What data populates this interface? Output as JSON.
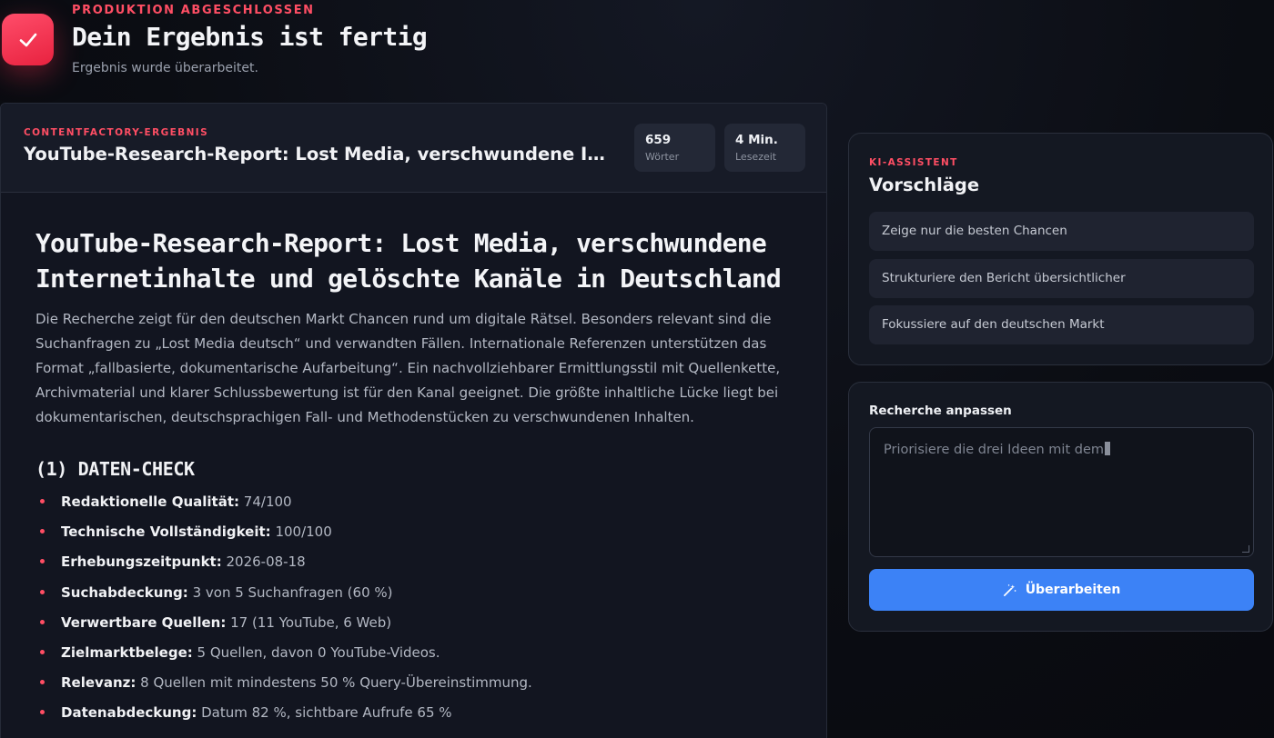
{
  "header": {
    "eyebrow": "PRODUKTION ABGESCHLOSSEN",
    "title": "Dein Ergebnis ist fertig",
    "subtitle": "Ergebnis wurde überarbeitet.",
    "badge_icon": "checkmark-icon",
    "accent": "#ff4e64"
  },
  "result": {
    "eyebrow": "CONTENTFACTORY-ERGEBNIS",
    "title": "YouTube-Research-Report: Lost Media, verschwundene Internetinhalte und gelöschte Kanäle in Deutschland",
    "stats": [
      {
        "value": "659",
        "label": "Wörter"
      },
      {
        "value": "4 Min.",
        "label": "Lesezeit"
      }
    ],
    "report": {
      "heading": "YouTube-Research-Report: Lost Media, verschwundene Internetinhalte und gelöschte Kanäle in Deutschland",
      "intro": "Die Recherche zeigt für den deutschen Markt Chancen rund um digitale Rätsel. Besonders relevant sind die Suchanfragen zu „Lost Media deutsch“ und verwandten Fällen. Internationale Referenzen unterstützen das Format „fallbasierte, dokumentarische Aufarbeitung“. Ein nachvollziehbarer Ermittlungsstil mit Quellenkette, Archivmaterial und klarer Schlussbewertung ist für den Kanal geeignet. Die größte inhaltliche Lücke liegt bei dokumentarischen, deutschsprachigen Fall- und Methodenstücken zu verschwundenen Inhalten.",
      "section_title": "(1) DATEN-CHECK",
      "facts": [
        {
          "key": "Redaktionelle Qualität:",
          "value": "74/100"
        },
        {
          "key": "Technische Vollständigkeit:",
          "value": "100/100"
        },
        {
          "key": "Erhebungszeitpunkt:",
          "value": "2026-08-18"
        },
        {
          "key": "Suchabdeckung:",
          "value": "3 von 5 Suchanfragen (60 %)"
        },
        {
          "key": "Verwertbare Quellen:",
          "value": "17 (11 YouTube, 6 Web)"
        },
        {
          "key": "Zielmarktbelege:",
          "value": "5 Quellen, davon 0 YouTube-Videos."
        },
        {
          "key": "Relevanz:",
          "value": "8 Quellen mit mindestens 50 % Query-Übereinstimmung."
        },
        {
          "key": "Datenabdeckung:",
          "value": "Datum 82 %, sichtbare Aufrufe 65 %"
        }
      ]
    }
  },
  "assistant": {
    "eyebrow": "KI-ASSISTENT",
    "title": "Vorschläge",
    "suggestions": [
      "Zeige nur die besten Chancen",
      "Strukturiere den Bericht übersichtlicher",
      "Fokussiere auf den deutschen Markt"
    ]
  },
  "adjust": {
    "label": "Recherche anpassen",
    "input_value": "Priorisiere die drei Ideen mit dem",
    "button_label": "Überarbeiten",
    "button_icon": "magic-wand-icon",
    "button_color": "#3c82f6"
  }
}
